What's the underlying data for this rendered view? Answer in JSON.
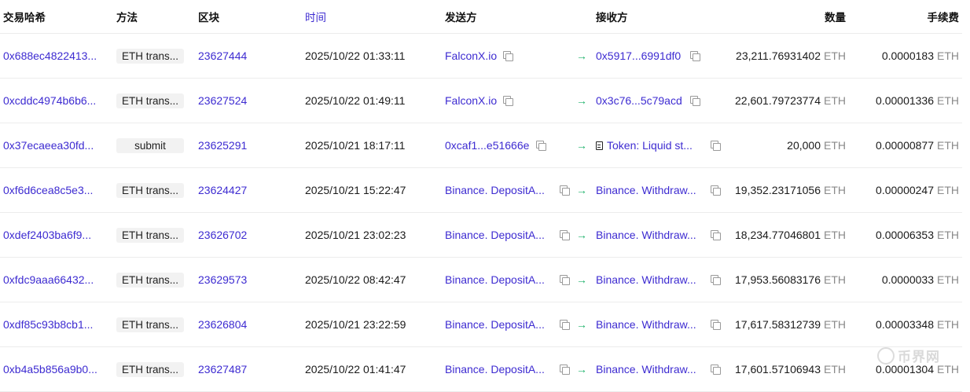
{
  "header": {
    "hash": "交易哈希",
    "method": "方法",
    "block": "区块",
    "time": "时间",
    "from": "发送方",
    "to": "接收方",
    "amount": "数量",
    "fee": "手续费"
  },
  "unit": "ETH",
  "rows": [
    {
      "hash": "0x688ec4822413...",
      "method": "ETH trans...",
      "block": "23627444",
      "time": "2025/10/22 01:33:11",
      "from": "FalconX.io",
      "to": "0x5917...6991df0",
      "amount": "23,211.76931402",
      "fee": "0.0000183"
    },
    {
      "hash": "0xcddc4974b6b6...",
      "method": "ETH trans...",
      "block": "23627524",
      "time": "2025/10/22 01:49:11",
      "from": "FalconX.io",
      "to": "0x3c76...5c79acd",
      "amount": "22,601.79723774",
      "fee": "0.00001336"
    },
    {
      "hash": "0x37ecaeea30fd...",
      "method": "submit",
      "block": "23625291",
      "time": "2025/10/21 18:17:11",
      "from": "0xcaf1...e51666e",
      "to": "Token: Liquid st...",
      "amount": "20,000",
      "fee": "0.00000877",
      "to_is_contract": true
    },
    {
      "hash": "0xf6d6cea8c5e3...",
      "method": "ETH trans...",
      "block": "23624427",
      "time": "2025/10/21 15:22:47",
      "from": "Binance. DepositA...",
      "to": "Binance. Withdraw...",
      "amount": "19,352.23171056",
      "fee": "0.00000247"
    },
    {
      "hash": "0xdef2403ba6f9...",
      "method": "ETH trans...",
      "block": "23626702",
      "time": "2025/10/21 23:02:23",
      "from": "Binance. DepositA...",
      "to": "Binance. Withdraw...",
      "amount": "18,234.77046801",
      "fee": "0.00006353"
    },
    {
      "hash": "0xfdc9aaa66432...",
      "method": "ETH trans...",
      "block": "23629573",
      "time": "2025/10/22 08:42:47",
      "from": "Binance. DepositA...",
      "to": "Binance. Withdraw...",
      "amount": "17,953.56083176",
      "fee": "0.0000033"
    },
    {
      "hash": "0xdf85c93b8cb1...",
      "method": "ETH trans...",
      "block": "23626804",
      "time": "2025/10/21 23:22:59",
      "from": "Binance. DepositA...",
      "to": "Binance. Withdraw...",
      "amount": "17,617.58312739",
      "fee": "0.00003348"
    },
    {
      "hash": "0xb4a5b856a9b0...",
      "method": "ETH trans...",
      "block": "23627487",
      "time": "2025/10/22 01:41:47",
      "from": "Binance. DepositA...",
      "to": "Binance. Withdraw...",
      "amount": "17,601.57106943",
      "fee": "0.00001304"
    }
  ],
  "watermark": "币界网",
  "colors": {
    "link": "#3d2bd1",
    "arrow": "#1fb36b",
    "unit": "#8a8a8a",
    "tag_bg": "#f2f2f2"
  }
}
